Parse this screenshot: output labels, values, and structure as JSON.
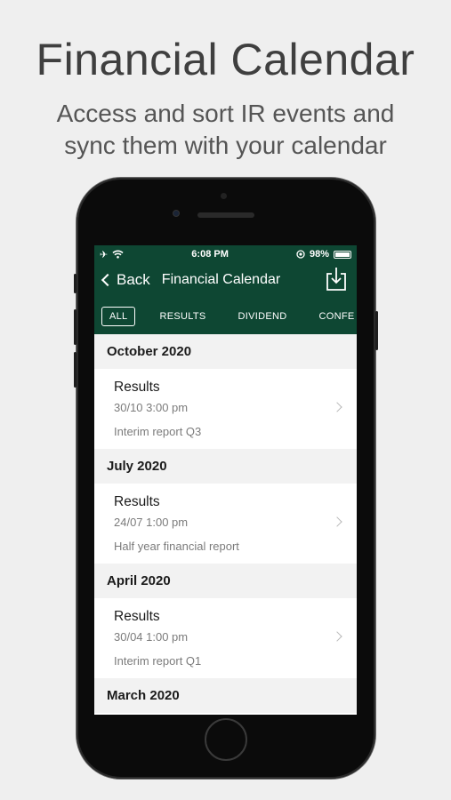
{
  "promo": {
    "title": "Financial Calendar",
    "subtitle_line1": "Access and sort IR events and",
    "subtitle_line2": "sync them with your calendar"
  },
  "status_bar": {
    "time": "6:08 PM",
    "battery": "98%"
  },
  "nav": {
    "back_label": "Back",
    "title": "Financial Calendar",
    "download_icon": "download-icon"
  },
  "tabs": [
    {
      "label": "ALL",
      "active": true
    },
    {
      "label": "RESULTS",
      "active": false
    },
    {
      "label": "DIVIDEND",
      "active": false
    },
    {
      "label": "CONFE",
      "active": false
    }
  ],
  "sections": [
    {
      "month": "October 2020",
      "event": {
        "title": "Results",
        "datetime": "30/10 3:00 pm",
        "description": "Interim report Q3"
      }
    },
    {
      "month": "July 2020",
      "event": {
        "title": "Results",
        "datetime": "24/07 1:00 pm",
        "description": "Half year financial report"
      }
    },
    {
      "month": "April 2020",
      "event": {
        "title": "Results",
        "datetime": "30/04 1:00 pm",
        "description": "Interim report Q1"
      }
    },
    {
      "month": "March 2020"
    }
  ],
  "colors": {
    "appbar": "#0e4733",
    "background": "#efefef"
  }
}
